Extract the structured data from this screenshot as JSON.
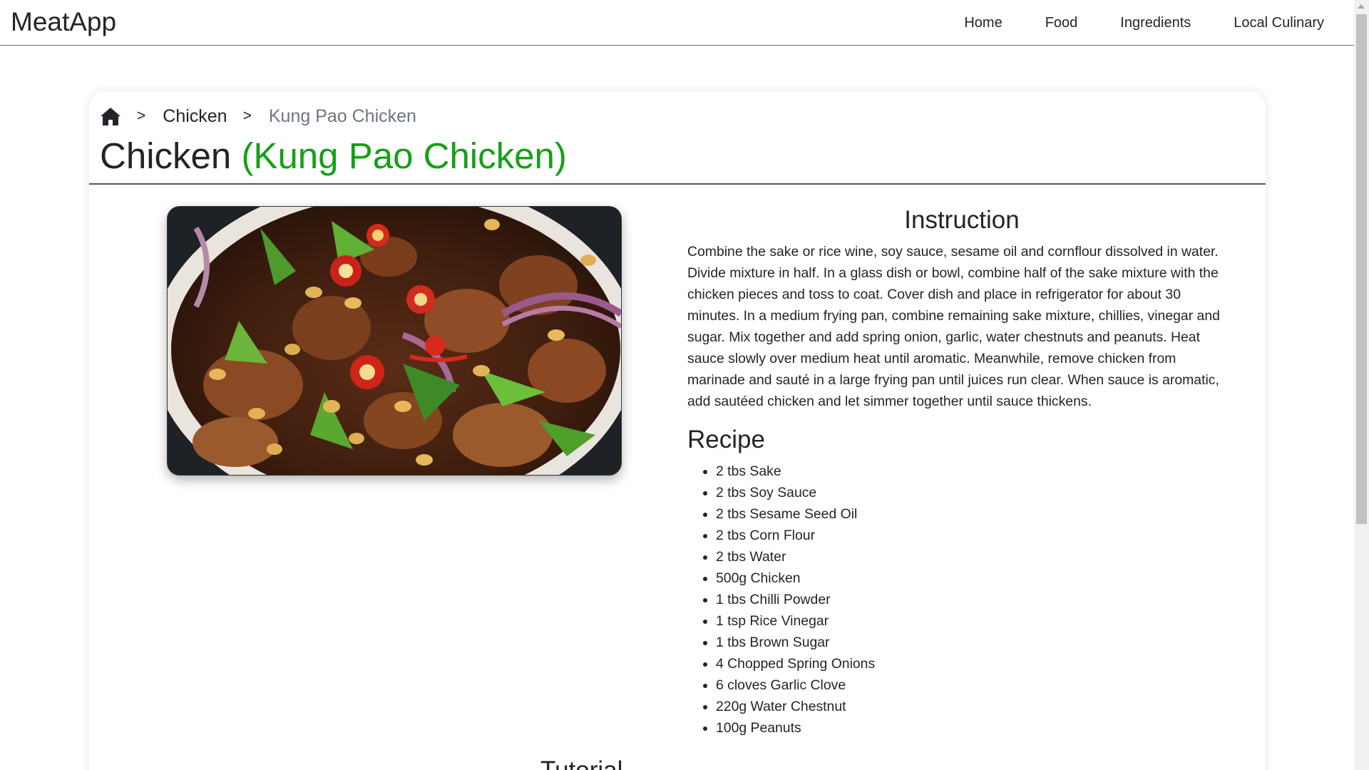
{
  "navbar": {
    "brand": "MeatApp",
    "links": [
      "Home",
      "Food",
      "Ingredients",
      "Local Culinary"
    ]
  },
  "breadcrumb": {
    "home_icon": "home-icon",
    "separator": ">",
    "category": "Chicken",
    "current": "Kung Pao Chicken"
  },
  "title": {
    "main": "Chicken",
    "sub": "(Kung Pao Chicken)",
    "sub_color": "#15a015"
  },
  "image": {
    "alt": "Kung Pao Chicken"
  },
  "instruction": {
    "heading": "Instruction",
    "text": "Combine the sake or rice wine, soy sauce, sesame oil and cornflour dissolved in water. Divide mixture in half. In a glass dish or bowl, combine half of the sake mixture with the chicken pieces and toss to coat. Cover dish and place in refrigerator for about 30 minutes. In a medium frying pan, combine remaining sake mixture, chillies, vinegar and sugar. Mix together and add spring onion, garlic, water chestnuts and peanuts. Heat sauce slowly over medium heat until aromatic. Meanwhile, remove chicken from marinade and sauté in a large frying pan until juices run clear. When sauce is aromatic, add sautéed chicken and let simmer together until sauce thickens."
  },
  "recipe": {
    "heading": "Recipe",
    "items": [
      "2 tbs Sake",
      "2 tbs Soy Sauce",
      "2 tbs Sesame Seed Oil",
      "2 tbs Corn Flour",
      "2 tbs Water",
      "500g Chicken",
      "1 tbs Chilli Powder",
      "1 tsp Rice Vinegar",
      "1 tbs Brown Sugar",
      "4 Chopped Spring Onions",
      "6 cloves Garlic Clove",
      "220g Water Chestnut",
      "100g Peanuts"
    ]
  },
  "tutorial": {
    "heading": "Tutorial"
  }
}
